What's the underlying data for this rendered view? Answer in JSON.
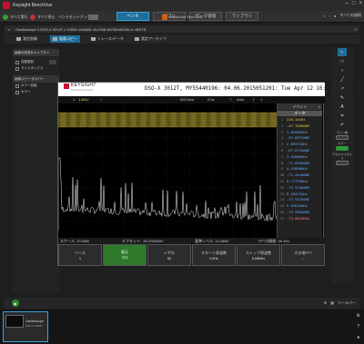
{
  "window": {
    "title": "Keysight BenchVue"
  },
  "toolbar": {
    "run_all": "すべて実行",
    "stop_all": "すべて停止",
    "new_device": "ベンチセットアップ",
    "test_flow": "BenchVue Test Flow",
    "tabs": [
      "ベンチ",
      "アプリ",
      "データ管理",
      "ライブラリ"
    ],
    "active_tab": 0,
    "right_label": "すべての接続"
  },
  "document": {
    "title": "Oscilloscope // DSO-X 3012T // USB0::0x2A8D::0x1768::MY55440196::0::INSTR",
    "subtabs": [
      "測定制御",
      "画面コピー",
      "トレース/データ",
      "測定アーカイブ"
    ],
    "active_subtab": 1
  },
  "left_panel": {
    "sections": [
      "画面の回収をキャプチャ",
      "画像/ステータスバー"
    ],
    "rows": [
      "自動更新",
      "サンドボックス",
      "カラー反転",
      "カラー"
    ]
  },
  "scope": {
    "brand": "KEYSIGHT",
    "brand_sub": "TECHNOLOGIES",
    "info": "DSO-X 3012T, MY55440196: 04.06.2015051201: Tue Apr 12 16:30:10 2016",
    "status": {
      "ch": "1",
      "volts": "1.80V/",
      "ch2": "2",
      "time": "500.0us/",
      "pos": "0.0s",
      "trig": "T",
      "mode": "Auto",
      "slope": "f",
      "lvl": "1"
    },
    "meas_title": "イベント",
    "meas_sub": "データ",
    "meas": [
      {
        "n": "1",
        "v": "218.101Hz",
        "c": "y"
      },
      {
        "n": "2",
        "v": "-47.7050dBV",
        "c": "y"
      },
      {
        "n": "3",
        "v": "1.04909kHz",
        "c": "b"
      },
      {
        "n": "4",
        "v": "-62.6872dBV",
        "c": "b"
      },
      {
        "n": "5",
        "v": "2.09272kHz",
        "c": "b"
      },
      {
        "n": "6",
        "v": "-67.6725dBV",
        "c": "b"
      },
      {
        "n": "7",
        "v": "3.52808kHz",
        "c": "b"
      },
      {
        "n": "8",
        "v": "-71.0555dBV",
        "c": "b"
      },
      {
        "n": "9",
        "v": "4.31888kHz",
        "c": "b"
      },
      {
        "n": "10",
        "v": "-71.4418dBV",
        "c": "b"
      },
      {
        "n": "11",
        "v": "6.77729kHz",
        "c": "b"
      },
      {
        "n": "12",
        "v": "-73.9246dBV",
        "c": "b"
      },
      {
        "n": "13",
        "v": "8.16422kHz",
        "c": "b"
      },
      {
        "n": "14",
        "v": "-73.9376dBV",
        "c": "b"
      },
      {
        "n": "15",
        "v": "9.92826kHz",
        "c": "b"
      },
      {
        "n": "16",
        "v": "-73.9594dBV",
        "c": "b"
      },
      {
        "n": "17",
        "v": "-73.0813kHz",
        "c": "r"
      }
    ],
    "bottom_line": {
      "scale": "スケール: 20.0dB/",
      "offset": "オフセット: -90.0000dBV",
      "ref": "基準レベル: 14.0dBV",
      "fft": "FFT分解能: 95.4Hz"
    },
    "softkeys": [
      {
        "label": "ソース",
        "sub": "1"
      },
      {
        "label": "表示",
        "sub": "平均"
      },
      {
        "label": "# 平均",
        "sub": "50"
      },
      {
        "label": "スタート周波数",
        "sub": "0.0Hz"
      },
      {
        "label": "ストップ周波数",
        "sub": "5.00MHz"
      },
      {
        "label": "その他FFT",
        "sub": "↓"
      }
    ]
  },
  "tool_panel": {
    "label1": "ライン幅",
    "label2": "カラー",
    "label3": "テキスト/スタイル"
  },
  "bottom": {
    "right": "ツールバー"
  },
  "thumb": {
    "title": "Oscilloscope",
    "sub": "DSO-X 3012T"
  }
}
